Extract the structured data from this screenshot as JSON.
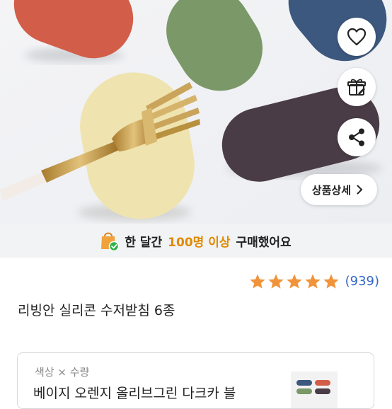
{
  "actions": {
    "heart_icon": "heart-outline",
    "gift_icon": "gift-outline",
    "share_icon": "share",
    "detail_label": "상품상세",
    "detail_chevron": "›"
  },
  "banner": {
    "prefix": "한 달간",
    "highlight": "100명 이상",
    "suffix": "구매했어요",
    "highlight_color": "#e08a00"
  },
  "rating": {
    "stars": 5,
    "star_color": "#f0933a",
    "count": "(939)"
  },
  "product": {
    "title": "리빙안 실리콘 수저받침 6종"
  },
  "option": {
    "label": "색상 × 수량",
    "value": "베이지 오렌지 올리브그린 다크카 블"
  }
}
